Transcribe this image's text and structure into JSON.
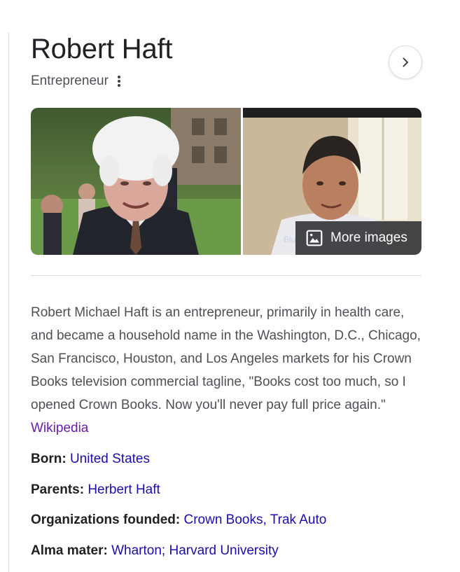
{
  "entity": {
    "name": "Robert Haft",
    "subtitle": "Entrepreneur"
  },
  "images": {
    "more_images_label": "More images",
    "caption_fragment": "Blue"
  },
  "description": {
    "text": "Robert Michael Haft is an entrepreneur, primarily in health care, and became a household name in the Washington, D.C., Chicago, San Francisco, Houston, and Los Angeles markets for his Crown Books television commercial tagline, \"Books cost too much, so I opened Crown Books. Now you'll never pay full price again.\" ",
    "source_link": "Wikipedia"
  },
  "facts": {
    "born": {
      "label": "Born:",
      "value": "United States"
    },
    "parents": {
      "label": "Parents:",
      "value": "Herbert Haft"
    },
    "organizations": {
      "label": "Organizations founded:",
      "values": [
        "Crown Books",
        "Trak Auto"
      ]
    },
    "alma_mater": {
      "label": "Alma mater:",
      "values": [
        "Wharton",
        "Harvard University"
      ]
    }
  },
  "colors": {
    "link": "#1a0dab",
    "visited_link": "#681da8",
    "text": "#202124",
    "secondary_text": "#4d5156"
  }
}
